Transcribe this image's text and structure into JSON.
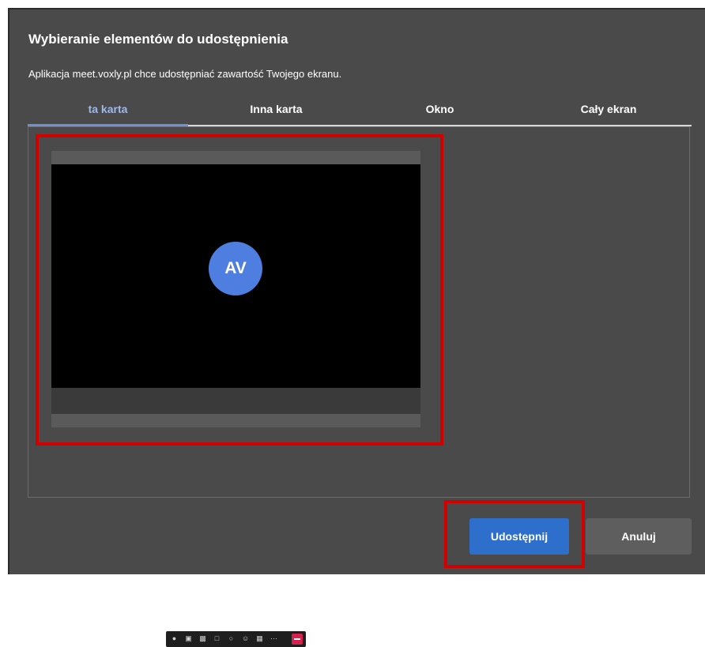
{
  "dialog": {
    "title": "Wybieranie elementów do udostępnienia",
    "subtitle": "Aplikacja meet.voxly.pl chce udostępniać zawartość Twojego ekranu."
  },
  "tabs": [
    {
      "label": "ta karta",
      "active": true
    },
    {
      "label": "Inna karta",
      "active": false
    },
    {
      "label": "Okno",
      "active": false
    },
    {
      "label": "Cały ekran",
      "active": false
    }
  ],
  "preview": {
    "avatar_initials": "AV"
  },
  "buttons": {
    "share_label": "Udostępnij",
    "cancel_label": "Anuluj"
  },
  "colors": {
    "accent": "#2f6fcc",
    "active_tab": "#9fb8ea",
    "highlight": "#d40000",
    "avatar": "#4e7ee0",
    "end_call": "#d6214c"
  },
  "toolbar_icons": [
    "mic-icon",
    "camera-icon",
    "screen-share-icon",
    "chat-icon",
    "raise-hand-icon",
    "reaction-icon",
    "grid-icon",
    "more-icon",
    "end-call-icon"
  ]
}
